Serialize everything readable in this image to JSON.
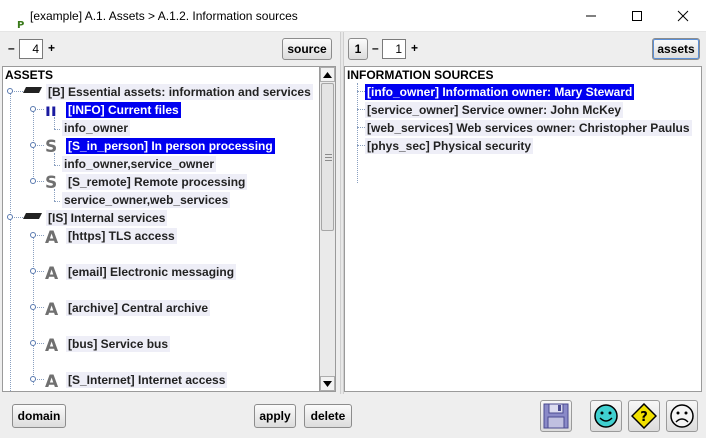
{
  "window": {
    "title": "[example] A.1. Assets > A.1.2. Information sources",
    "logo_letter": "P",
    "logo_sub": "c"
  },
  "left_pane": {
    "toolbar": {
      "minus": "–",
      "level": "4",
      "plus": "+",
      "source_button": "source"
    },
    "header": "ASSETS",
    "tree": [
      {
        "id": "b",
        "icon": "tray-icon",
        "label": "[B] Essential assets: information and services",
        "style": "light"
      },
      {
        "id": "info",
        "icon": "ii",
        "label": "[INFO] Current files",
        "style": "sel",
        "sub": "info_owner"
      },
      {
        "id": "s_in_person",
        "icon": "S",
        "label": "[S_in_person] In person processing",
        "style": "sel",
        "sub": "info_owner,service_owner"
      },
      {
        "id": "s_remote",
        "icon": "S",
        "label": "[S_remote] Remote processing",
        "style": "light",
        "sub": "service_owner,web_services"
      },
      {
        "id": "is",
        "icon": "tray-icon",
        "label": "[IS] Internal services",
        "style": "light"
      },
      {
        "id": "https",
        "icon": "A",
        "label": "[https] TLS access",
        "style": "light"
      },
      {
        "id": "email",
        "icon": "A",
        "label": "[email] Electronic messaging",
        "style": "light"
      },
      {
        "id": "archive",
        "icon": "A",
        "label": "[archive] Central archive",
        "style": "light"
      },
      {
        "id": "bus",
        "icon": "A",
        "label": "[bus] Service bus",
        "style": "light"
      },
      {
        "id": "s_internet",
        "icon": "A",
        "label": "[S_Internet] Internet access",
        "style": "light"
      }
    ]
  },
  "right_pane": {
    "toolbar": {
      "one": "1",
      "minus": "–",
      "level": "1",
      "plus": "+",
      "assets_button": "assets"
    },
    "header": "INFORMATION SOURCES",
    "items": [
      {
        "label": "[info_owner] Information owner: Mary Steward",
        "selected": true
      },
      {
        "label": "[service_owner] Service owner: John McKey",
        "selected": false
      },
      {
        "label": "[web_services] Web services owner: Christopher Paulus",
        "selected": false
      },
      {
        "label": "[phys_sec] Physical security",
        "selected": false
      }
    ]
  },
  "bottom_bar": {
    "domain_button": "domain",
    "apply_button": "apply",
    "delete_button": "delete",
    "icons": [
      "save-icon",
      "happy-face-icon",
      "help-icon",
      "sad-face-icon"
    ]
  },
  "colors": {
    "selection": "#0000f0",
    "light_row": "#eeeef7",
    "panel_bg": "#eeeeee",
    "tree_line": "#8aa0c0",
    "logo": "#f0a000"
  }
}
